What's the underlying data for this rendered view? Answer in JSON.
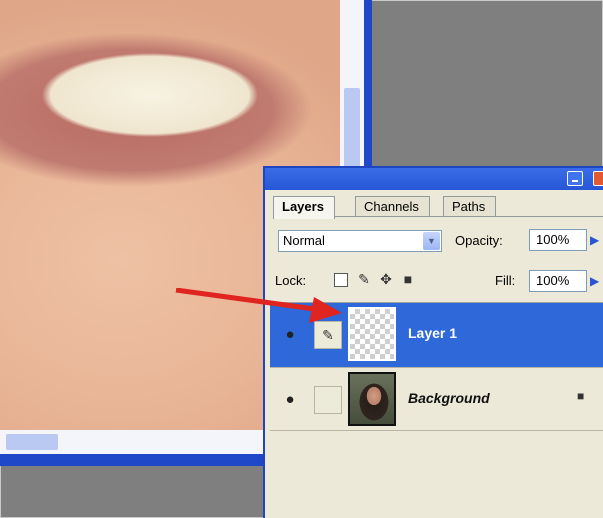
{
  "palette": {
    "tabs": [
      "Layers",
      "Channels",
      "Paths"
    ],
    "blend_mode": "Normal",
    "opacity_label": "Opacity:",
    "opacity_value": "100%",
    "lock_label": "Lock:",
    "fill_label": "Fill:",
    "fill_value": "100%",
    "layers": [
      {
        "name": "Layer 1",
        "selected": true
      },
      {
        "name": "Background",
        "selected": false,
        "locked": true
      }
    ]
  },
  "icons": {
    "eye": "eye-icon",
    "link": "link-icon",
    "lock": "lock-icon",
    "lock_transparency": "lock-transparency-icon",
    "lock_paint": "brush-icon",
    "lock_move": "move-icon"
  },
  "colors": {
    "accent": "#2f68d8",
    "arrow": "#e0241f"
  }
}
